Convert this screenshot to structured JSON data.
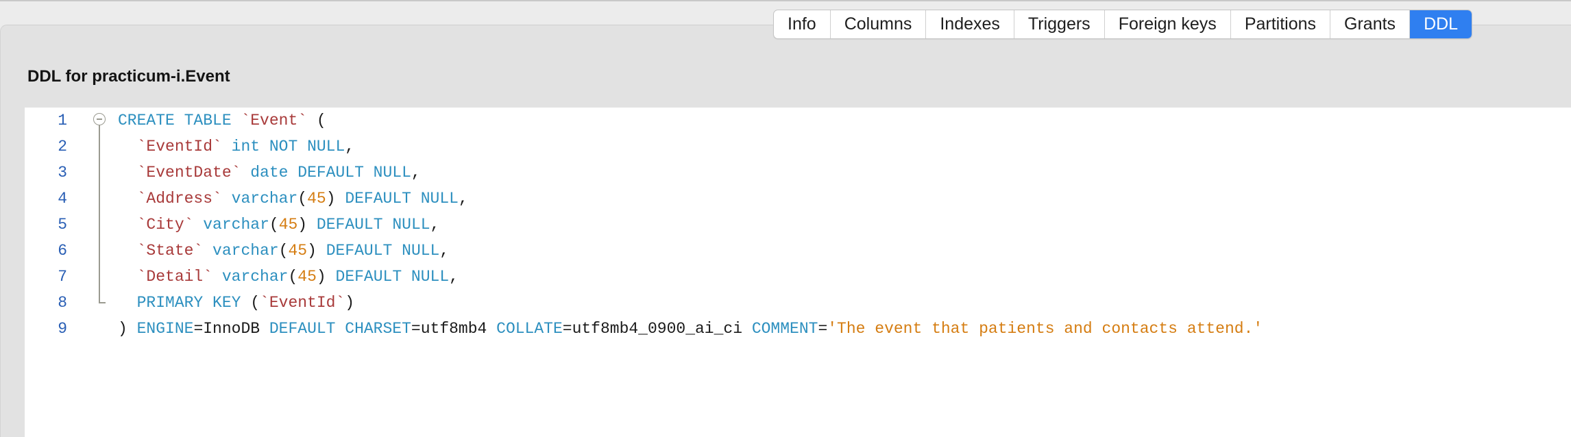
{
  "tabs": [
    "Info",
    "Columns",
    "Indexes",
    "Triggers",
    "Foreign keys",
    "Partitions",
    "Grants",
    "DDL"
  ],
  "active_tab": "DDL",
  "panel_title": "DDL for practicum-i.Event",
  "line_numbers": [
    "1",
    "2",
    "3",
    "4",
    "5",
    "6",
    "7",
    "8",
    "9"
  ],
  "code": {
    "l1": {
      "create_table": "CREATE TABLE",
      "sp": " ",
      "table_name": "`Event`",
      "paren": " ("
    },
    "l2": {
      "indent": "  ",
      "col": "`EventId`",
      "sp": " ",
      "type": "int NOT NULL",
      "end": ","
    },
    "l3": {
      "indent": "  ",
      "col": "`EventDate`",
      "sp": " ",
      "type": "date DEFAULT NULL",
      "end": ","
    },
    "l4": {
      "indent": "  ",
      "col": "`Address`",
      "sp": " ",
      "type": "varchar",
      "lp": "(",
      "len": "45",
      "rp": ")",
      "sp2": " ",
      "def": "DEFAULT NULL",
      "end": ","
    },
    "l5": {
      "indent": "  ",
      "col": "`City`",
      "sp": " ",
      "type": "varchar",
      "lp": "(",
      "len": "45",
      "rp": ")",
      "sp2": " ",
      "def": "DEFAULT NULL",
      "end": ","
    },
    "l6": {
      "indent": "  ",
      "col": "`State`",
      "sp": " ",
      "type": "varchar",
      "lp": "(",
      "len": "45",
      "rp": ")",
      "sp2": " ",
      "def": "DEFAULT NULL",
      "end": ","
    },
    "l7": {
      "indent": "  ",
      "col": "`Detail`",
      "sp": " ",
      "type": "varchar",
      "lp": "(",
      "len": "45",
      "rp": ")",
      "sp2": " ",
      "def": "DEFAULT NULL",
      "end": ","
    },
    "l8": {
      "indent": "  ",
      "kw": "PRIMARY KEY",
      "lp": " (",
      "col": "`EventId`",
      "rp": ")"
    },
    "l9": {
      "close": ") ",
      "engine_kw": "ENGINE",
      "eq1": "=InnoDB ",
      "charset_kw": "DEFAULT CHARSET",
      "eq2": "=utf8mb4 ",
      "collate_kw": "COLLATE",
      "eq3": "=utf8mb4_0900_ai_ci ",
      "comment_kw": "COMMENT",
      "eq4": "=",
      "comment": "'The event that patients and contacts attend.'"
    }
  },
  "colors": {
    "keyword": "#2c8fbf",
    "identifier": "#a83a3a",
    "number": "#d57d12",
    "string": "#d57d12",
    "active_tab": "#2f7ff0",
    "line_number": "#2a5fb5"
  }
}
